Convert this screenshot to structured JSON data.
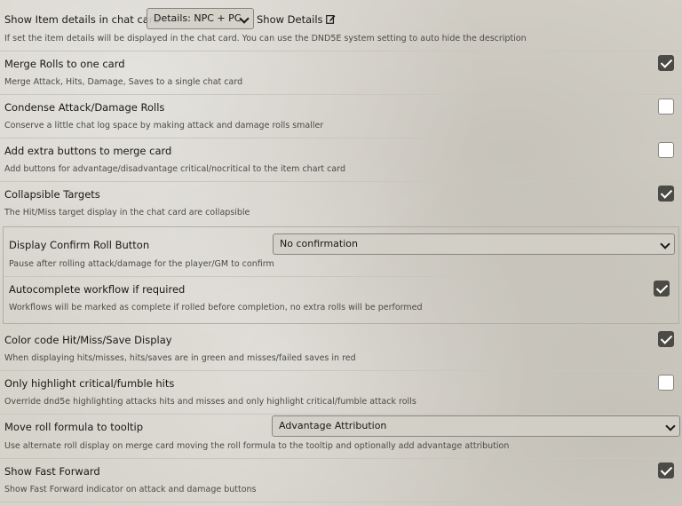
{
  "item_details": {
    "label": "Show Item details in chat card",
    "select_value": "Details: NPC + PC",
    "show_details_label": "Show Details",
    "hint": "If set the item details will be displayed in the chat card. You can use the DND5E system setting to auto hide the description"
  },
  "merge_rolls": {
    "label": "Merge Rolls to one card",
    "hint": "Merge Attack, Hits, Damage, Saves to a single chat card",
    "checked": true
  },
  "condense_rolls": {
    "label": "Condense Attack/Damage Rolls",
    "hint": "Conserve a little chat log space by making attack and damage rolls smaller",
    "checked": false
  },
  "extra_buttons": {
    "label": "Add extra buttons to merge card",
    "hint": "Add buttons for advantage/disadvantage critical/nocritical to the item chart card",
    "checked": false
  },
  "collapsible_targets": {
    "label": "Collapsible Targets",
    "hint": "The Hit/Miss target display in the chat card are collapsible",
    "checked": true
  },
  "confirm_roll": {
    "label": "Display Confirm Roll Button",
    "select_value": "No confirmation",
    "hint": "Pause after rolling attack/damage for the player/GM to confirm"
  },
  "autocomplete": {
    "label": "Autocomplete workflow if required",
    "hint": "Workflows will be marked as complete if rolled before completion, no extra rolls will be performed",
    "checked": true
  },
  "color_code": {
    "label": "Color code Hit/Miss/Save Display",
    "hint": "When displaying hits/misses, hits/saves are in green and misses/failed saves in red",
    "checked": true
  },
  "highlight_critical": {
    "label": "Only highlight critical/fumble hits",
    "hint": "Override dnd5e highlighting attacks hits and misses and only highlight critical/fumble attack rolls",
    "checked": false
  },
  "roll_formula": {
    "label": "Move roll formula to tooltip",
    "select_value": "Advantage Attribution",
    "hint": "Use alternate roll display on merge card moving the roll formula to the tooltip and optionally add advantage attribution"
  },
  "fast_forward": {
    "label": "Show Fast Forward",
    "hint": "Show Fast Forward indicator on attack and damage buttons",
    "checked": true
  }
}
